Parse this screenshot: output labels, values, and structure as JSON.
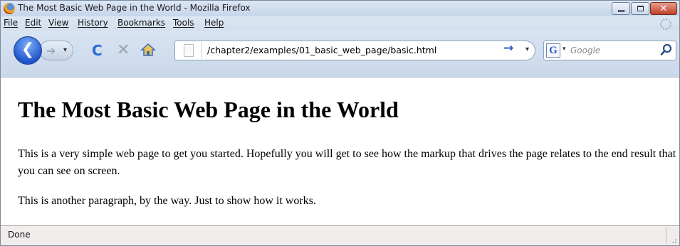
{
  "window": {
    "title": "The Most Basic Web Page in the World - Mozilla Firefox",
    "controls": {
      "close_glyph": "✕"
    }
  },
  "menu": {
    "items": [
      {
        "label": "File"
      },
      {
        "label": "Edit"
      },
      {
        "label": "View"
      },
      {
        "label": "History"
      },
      {
        "label": "Bookmarks"
      },
      {
        "label": "Tools"
      },
      {
        "label": "Help"
      }
    ]
  },
  "toolbar": {
    "back_icon": "back-arrow-icon",
    "forward_icon": "forward-arrow-icon",
    "reload_glyph": "C",
    "stop_glyph": "✕",
    "url": "/chapter2/examples/01_basic_web_page/basic.html",
    "go_glyph": "→",
    "dropdown_glyph": "▾",
    "search_engine_glyph": "G",
    "search_placeholder": "Google"
  },
  "page": {
    "heading": "The Most Basic Web Page in the World",
    "paragraphs": [
      "This is a very simple web page to get you started. Hopefully you will get to see how the markup that drives the page relates to the end result that you can see on screen.",
      "This is another paragraph, by the way. Just to show how it works."
    ]
  },
  "status": {
    "text": "Done"
  },
  "colors": {
    "chrome": "#c9d8ea",
    "back_button": "#1f56c9",
    "reload": "#2d69d6",
    "close_button": "#c0402a",
    "status_bar": "#f1edec"
  }
}
